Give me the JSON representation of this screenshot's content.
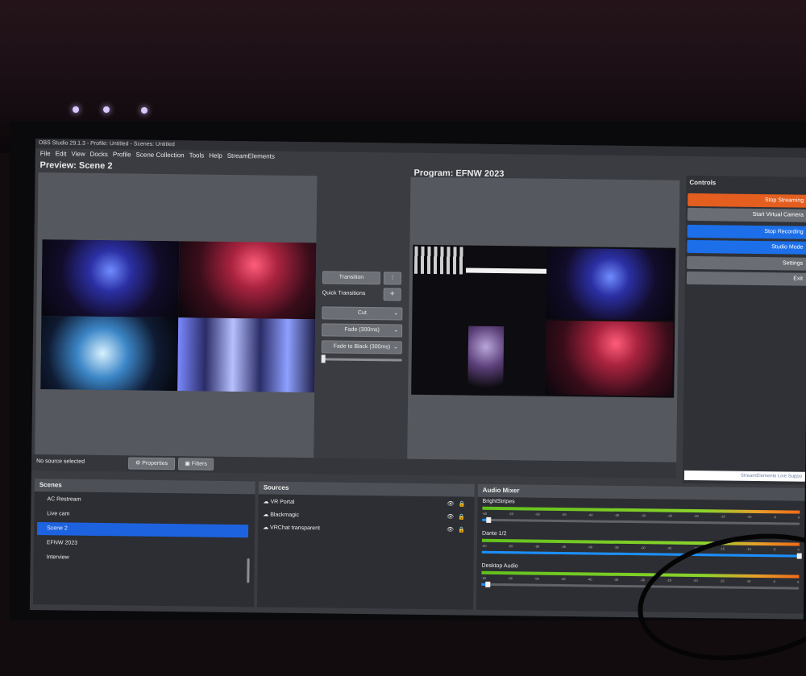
{
  "window": {
    "title": "OBS Studio 29.1.3 - Profile: Untitled - Scenes: Untitled"
  },
  "menu": [
    "File",
    "Edit",
    "View",
    "Docks",
    "Profile",
    "Scene Collection",
    "Tools",
    "Help",
    "StreamElements"
  ],
  "preview": {
    "title": "Preview: Scene 2"
  },
  "program": {
    "title": "Program: EFNW 2023"
  },
  "transition": {
    "transition_label": "Transition",
    "quick_label": "Quick Transitions",
    "options": [
      "Cut",
      "Fade (300ms)",
      "Fade to Black (300ms)"
    ],
    "add_icon": "+",
    "more_icon": "⋮",
    "slider_level": 0
  },
  "controls": {
    "title": "Controls",
    "buttons": [
      {
        "label": "Stop Streaming",
        "color": "#e35e1f"
      },
      {
        "label": "Start Virtual Camera",
        "color": "#6a6d73"
      },
      {
        "label": "Stop Recording",
        "color": "#1c6fe8"
      },
      {
        "label": "Studio Mode",
        "color": "#1c6fe8"
      },
      {
        "label": "Settings",
        "color": "#6a6d73"
      },
      {
        "label": "Exit",
        "color": "#6a6d73"
      }
    ],
    "footer": "StreamElements Live Suppo"
  },
  "source_bar": {
    "status": "No source selected",
    "properties": "Properties",
    "filters": "Filters"
  },
  "scenes": {
    "title": "Scenes",
    "items": [
      "AC Restream",
      "Live cam",
      "Scene 2",
      "EFNW 2023",
      "Interview"
    ],
    "selected_index": 2
  },
  "sources": {
    "title": "Sources",
    "items": [
      "VR Portal",
      "Blackmagic",
      "VRChat transparent"
    ]
  },
  "audio": {
    "title": "Audio Mixer",
    "channels": [
      {
        "name": "BrightStripes",
        "volume": 0.02
      },
      {
        "name": "Dante 1/2",
        "volume": 1.0
      },
      {
        "name": "Desktop Audio",
        "volume": 0.02
      }
    ],
    "ticks": [
      "-60",
      "-55",
      "-50",
      "-45",
      "-40",
      "-35",
      "-30",
      "-25",
      "-20",
      "-15",
      "-10",
      "-5",
      "0"
    ]
  },
  "colors": {
    "accent": "#1c6fe8",
    "streaming": "#e35e1f",
    "panel": "#2c2e33",
    "preview_bg": "#55585e"
  }
}
